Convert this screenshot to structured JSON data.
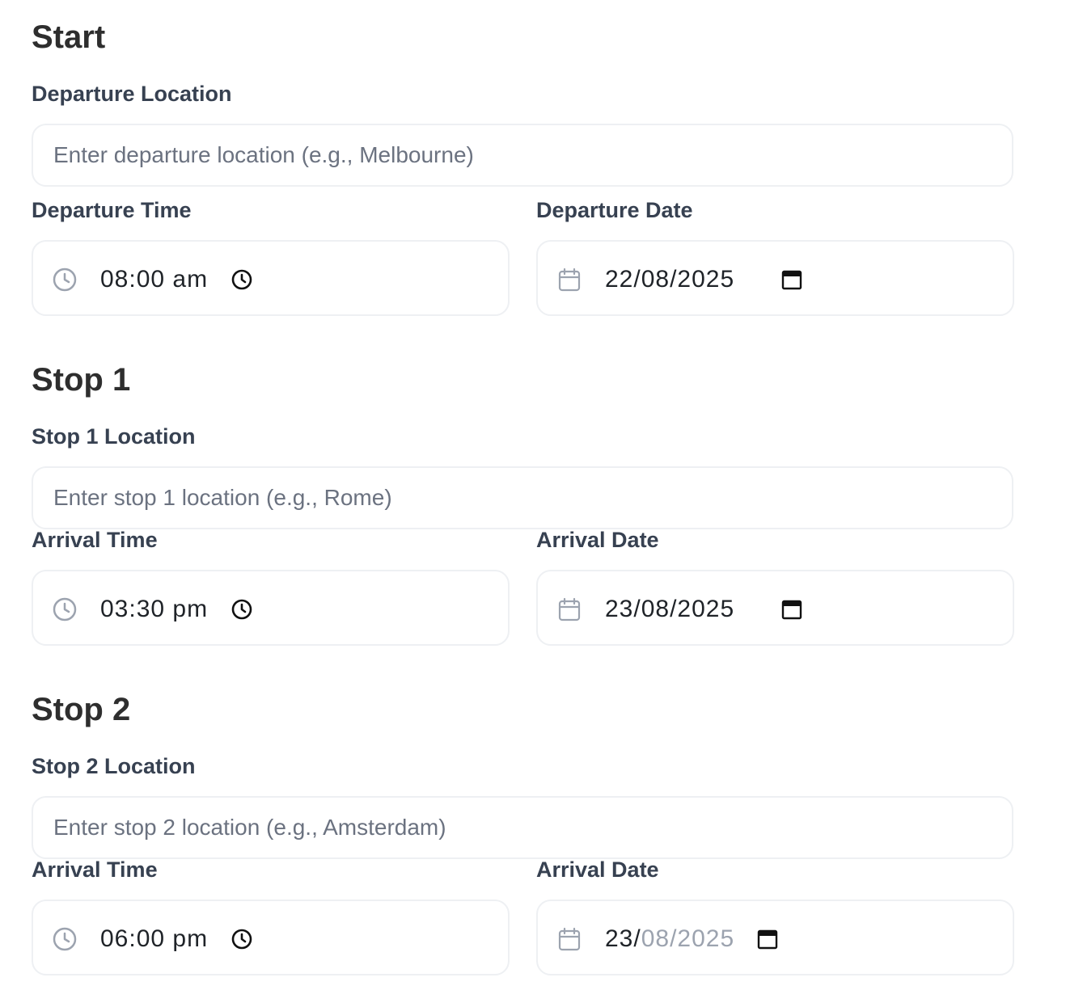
{
  "sections": [
    {
      "heading": "Start",
      "location_label": "Departure Location",
      "location_placeholder": "Enter departure location (e.g., Melbourne)",
      "time_label": "Departure Time",
      "time_value": "08:00 am",
      "date_label": "Departure Date",
      "date_value": "22/08/2025"
    },
    {
      "heading": "Stop 1",
      "location_label": "Stop 1 Location",
      "location_placeholder": "Enter stop 1 location (e.g., Rome)",
      "time_label": "Arrival Time",
      "time_value": "03:30 pm",
      "date_label": "Arrival Date",
      "date_value": "23/08/2025"
    },
    {
      "heading": "Stop 2",
      "location_label": "Stop 2 Location",
      "location_placeholder": "Enter stop 2 location (e.g., Amsterdam)",
      "time_label": "Arrival Time",
      "time_value": "06:00 pm",
      "date_label": "Arrival Date",
      "date_day": "23/",
      "date_month_year": "08/2025"
    }
  ],
  "icons": {
    "leading_time": "clock-icon",
    "trailing_time": "clock-picker-icon",
    "leading_date": "calendar-icon",
    "trailing_date": "calendar-picker-icon"
  },
  "colors": {
    "heading": "#2e2e2e",
    "label": "#374151",
    "placeholder": "#6b7280",
    "value": "#1f2328",
    "border": "#eef0f3",
    "icon_muted": "#9ca3af"
  }
}
